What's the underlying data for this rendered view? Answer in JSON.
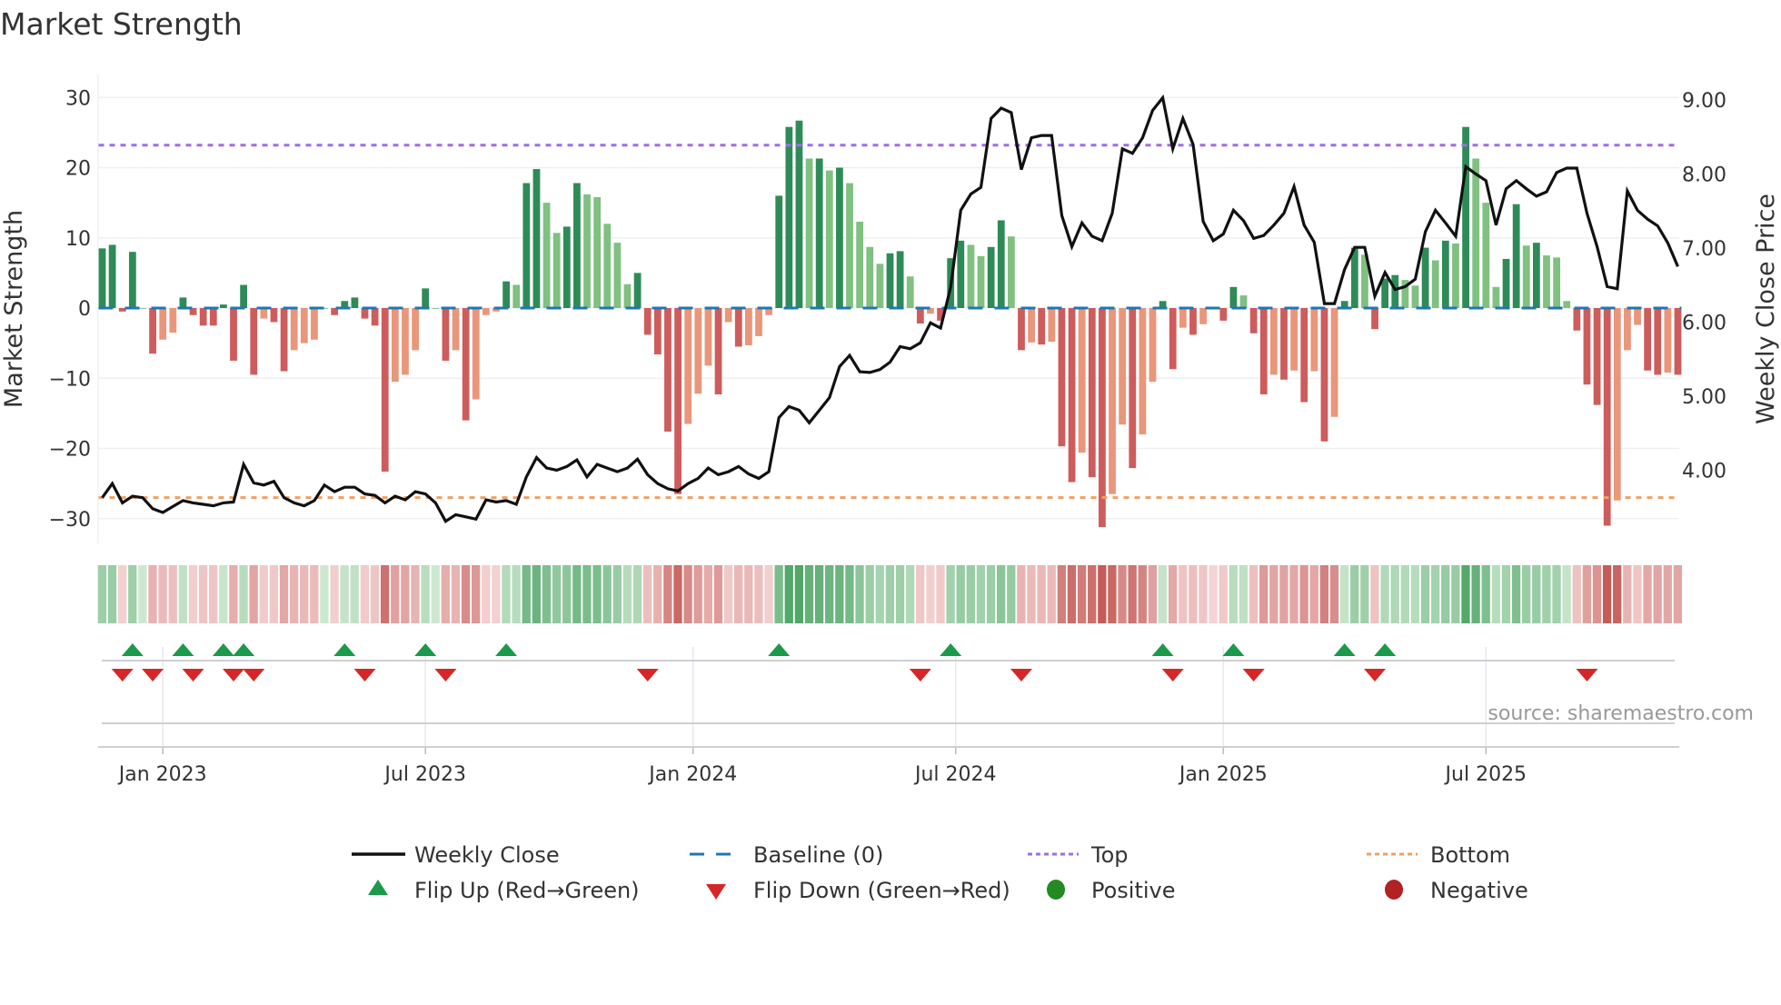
{
  "chart_data": {
    "type": "bar",
    "title": "Market Strength",
    "ylabel": "Market Strength",
    "y2label": "Weekly Close Price",
    "ylim": [
      -33,
      32
    ],
    "y2lim": [
      3.2,
      9.25
    ],
    "yticks": [
      "30",
      "20",
      "10",
      "0",
      "−10",
      "−20",
      "−30"
    ],
    "ytick_values": [
      30,
      20,
      10,
      0,
      -10,
      -20,
      -30
    ],
    "y2ticks": [
      "9.00",
      "8.00",
      "7.00",
      "6.00",
      "5.00",
      "4.00"
    ],
    "y2tick_values": [
      9,
      8,
      7,
      6,
      5,
      4
    ],
    "xticks": [
      "Jan 2023",
      "Jul 2023",
      "Jan 2024",
      "Jul 2024",
      "Jan 2025",
      "Jul 2025"
    ],
    "xtick_week_index": [
      6,
      32,
      58.5,
      84.5,
      111,
      137
    ],
    "top_level": 23.2,
    "bottom_level": -27,
    "strength": [
      8.5,
      9,
      -0.5,
      8,
      0,
      -6.5,
      -4.5,
      -3.5,
      1.5,
      -1,
      -2.5,
      -2.5,
      0.5,
      -7.5,
      3.3,
      -9.5,
      -1.5,
      -2,
      -9,
      -6,
      -5,
      -4.5,
      0,
      -1,
      1,
      1.5,
      -1.5,
      -2.5,
      -23.3,
      -10.5,
      -9.5,
      -6,
      2.8,
      0,
      -7.5,
      -6,
      -16,
      -13,
      -1,
      -0.5,
      3.8,
      3.3,
      17.8,
      19.8,
      15,
      10.7,
      11.6,
      17.8,
      16.2,
      15.8,
      12,
      9.3,
      3.4,
      5,
      -3.8,
      -6.6,
      -17.6,
      -26.5,
      -16.5,
      -12.2,
      -8.2,
      -12.3,
      -2,
      -5.5,
      -5.3,
      -4,
      -1,
      16,
      25.8,
      26.7,
      21.3,
      21.3,
      19.6,
      20,
      17.8,
      12.3,
      8.7,
      6.3,
      7.8,
      8.1,
      4.5,
      -2.2,
      -0.8,
      -1.8,
      7.1,
      9.6,
      9,
      7.4,
      8.7,
      12.5,
      10.2,
      -6,
      -4.9,
      -5.2,
      -4.8,
      -19.7,
      -24.8,
      -20.6,
      -24.1,
      -31.2,
      -26.5,
      -16.6,
      -22.8,
      -18,
      -10.5,
      1,
      -8.7,
      -2.8,
      -3.8,
      -2.3,
      -0.2,
      -1.8,
      3,
      1.8,
      -3.6,
      -12.3,
      -9.5,
      -10.2,
      -8.9,
      -13.4,
      -9,
      -19,
      -15.5,
      1,
      8.6,
      7.6,
      -3,
      4.2,
      4.7,
      4,
      3.2,
      8.6,
      6.8,
      9.6,
      9.2,
      25.8,
      21.3,
      15,
      3,
      7,
      14.8,
      8.9,
      9.3,
      7.5,
      7.2,
      1,
      -3.2,
      -10.9,
      -13.8,
      -31,
      -27.4,
      -6,
      -2.4,
      -8.9,
      -9.5,
      -9.2,
      -9.5
    ],
    "weekly_close": [
      3.63,
      3.82,
      3.56,
      3.65,
      3.63,
      3.48,
      3.43,
      3.51,
      3.59,
      3.56,
      3.54,
      3.52,
      3.56,
      3.57,
      4.08,
      3.83,
      3.8,
      3.85,
      3.63,
      3.56,
      3.52,
      3.59,
      3.8,
      3.71,
      3.77,
      3.77,
      3.68,
      3.66,
      3.56,
      3.65,
      3.6,
      3.71,
      3.68,
      3.56,
      3.31,
      3.4,
      3.37,
      3.34,
      3.6,
      3.57,
      3.59,
      3.54,
      3.91,
      4.17,
      4.03,
      4.0,
      4.05,
      4.14,
      3.91,
      4.08,
      4.03,
      3.98,
      4.03,
      4.15,
      3.94,
      3.82,
      3.75,
      3.72,
      3.82,
      3.89,
      4.03,
      3.94,
      3.98,
      4.05,
      3.95,
      3.89,
      3.98,
      4.71,
      4.86,
      4.81,
      4.64,
      4.81,
      4.98,
      5.4,
      5.55,
      5.33,
      5.32,
      5.36,
      5.46,
      5.67,
      5.64,
      5.72,
      5.99,
      5.92,
      6.47,
      7.51,
      7.73,
      7.82,
      8.75,
      8.89,
      8.83,
      8.06,
      8.49,
      8.52,
      8.52,
      7.44,
      7.02,
      7.34,
      7.16,
      7.1,
      7.47,
      8.34,
      8.28,
      8.49,
      8.86,
      9.03,
      8.34,
      8.75,
      8.4,
      7.36,
      7.1,
      7.19,
      7.51,
      7.37,
      7.13,
      7.17,
      7.31,
      7.47,
      7.83,
      7.31,
      7.08,
      6.25,
      6.25,
      6.71,
      7.01,
      7.01,
      6.35,
      6.67,
      6.44,
      6.48,
      6.58,
      7.22,
      7.51,
      7.34,
      7.16,
      8.1,
      8.0,
      7.91,
      7.31,
      7.8,
      7.91,
      7.8,
      7.7,
      7.76,
      8.02,
      8.08,
      8.08,
      7.47,
      7.02,
      6.48,
      6.45,
      7.77,
      7.51,
      7.39,
      7.3,
      7.07,
      6.75
    ],
    "flip_up_week_index": [
      3,
      8,
      12,
      14,
      24,
      32,
      40,
      67,
      84,
      105,
      112,
      123,
      127
    ],
    "flip_down_week_index": [
      2,
      5,
      9,
      13,
      15,
      26,
      34,
      54,
      81,
      91,
      106,
      114,
      126,
      147
    ],
    "colors": {
      "pos_dark": "#2e8b57",
      "pos_light": "#80c080",
      "neg_dark": "#cd5c5c",
      "neg_light": "#e9967a",
      "line": "#111111",
      "baseline": "#1f77b4",
      "top": "#9b6ee8",
      "bottom": "#f0a060",
      "flip_up": "#1a9a4a",
      "flip_down": "#d62728",
      "positive": "#228b22",
      "negative": "#b22222"
    },
    "legend": {
      "weekly_close": "Weekly Close",
      "baseline": "Baseline (0)",
      "top": "Top",
      "bottom": "Bottom",
      "flip_up": "Flip Up (Red→Green)",
      "flip_down": "Flip Down (Green→Red)",
      "positive": "Positive",
      "negative": "Negative"
    },
    "legend_placement": "bottom",
    "grid": true
  },
  "source": "source: sharemaestro.com"
}
